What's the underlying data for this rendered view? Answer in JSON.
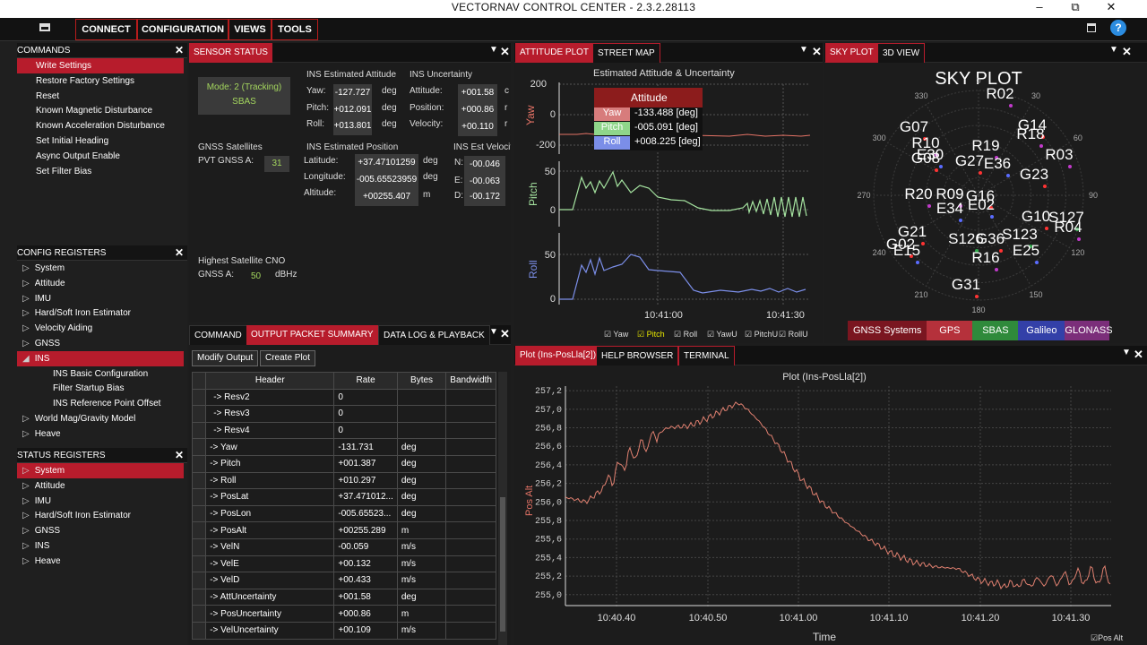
{
  "window": {
    "title": "VECTORNAV CONTROL CENTER - 2.3.2.28113",
    "minimize": "–",
    "restore": "⧉",
    "close": "✕"
  },
  "menu": {
    "connect": "CONNECT",
    "configuration": "CONFIGURATION",
    "views": "VIEWS",
    "tools": "TOOLS"
  },
  "commands": {
    "title": "COMMANDS",
    "items": [
      "Write Settings",
      "Restore Factory Settings",
      "Reset",
      "Known Magnetic Disturbance",
      "Known Acceleration Disturbance",
      "Set Initial Heading",
      "Async Output Enable",
      "Set Filter Bias"
    ]
  },
  "config": {
    "title": "CONFIG REGISTERS",
    "items": [
      "System",
      "Attitude",
      "IMU",
      "Hard/Soft Iron Estimator",
      "Velocity Aiding",
      "GNSS",
      "INS"
    ],
    "ins_children": [
      "INS Basic Configuration",
      "Filter Startup Bias",
      "INS Reference Point Offset"
    ],
    "after": [
      "World Mag/Gravity Model",
      "Heave"
    ]
  },
  "status": {
    "title": "STATUS REGISTERS",
    "items": [
      "System",
      "Attitude",
      "IMU",
      "Hard/Soft Iron Estimator",
      "GNSS",
      "INS",
      "Heave"
    ]
  },
  "sensor": {
    "tab": "SENSOR STATUS",
    "mode": "Mode: 2 (Tracking)",
    "sbas": "SBAS",
    "att_title": "INS Estimated Attitude",
    "yaw_l": "Yaw:",
    "yaw": "-127.727",
    "pitch_l": "Pitch:",
    "pitch": "+012.091",
    "roll_l": "Roll:",
    "roll": "+013.801",
    "deg": "deg",
    "unc_title": "INS Uncertainty",
    "att_l": "Attitude:",
    "att_u": "+001.58",
    "pos_l": "Position:",
    "pos_u": "+000.86",
    "vel_l": "Velocity:",
    "vel_u": "+00.110",
    "unc_unit1": "c",
    "unc_unit2": "r",
    "unc_unit3": "r",
    "gnss_title": "GNSS Satellites",
    "pvt_l": "PVT GNSS A:",
    "pvt": "31",
    "posn_title": "INS Estimated Position",
    "lat_l": "Latitude:",
    "lat": "+37.47101259",
    "lon_l": "Longitude:",
    "lon": "-005.65523959",
    "alt_l": "Altitude:",
    "alt": "+00255.407",
    "m": "m",
    "vel_title": "INS Est Velocit",
    "n_l": "N:",
    "n": "-00.046",
    "e_l": "E:",
    "e": "-00.063",
    "d_l": "D:",
    "d": "-00.172",
    "cno_title": "Highest Satellite CNO",
    "cno_l": "GNSS A:",
    "cno": "50",
    "cno_unit": "dBHz"
  },
  "bottom_tabs": {
    "command": "COMMAND",
    "output": "OUTPUT PACKET SUMMARY",
    "datalog": "DATA LOG & PLAYBACK",
    "modify": "Modify Output",
    "create": "Create Plot"
  },
  "packet": {
    "headers": [
      "Header",
      "Rate",
      "Bytes",
      "Bandwidth"
    ],
    "rows": [
      [
        "-> Resv2",
        "0",
        ""
      ],
      [
        "-> Resv3",
        "0",
        ""
      ],
      [
        "-> Resv4",
        "0",
        ""
      ],
      [
        "-> Yaw",
        "-131.731",
        "deg"
      ],
      [
        "-> Pitch",
        "+001.387",
        "deg"
      ],
      [
        "-> Roll",
        "+010.297",
        "deg"
      ],
      [
        "-> PosLat",
        "+37.471012...",
        "deg"
      ],
      [
        "-> PosLon",
        "-005.65523...",
        "deg"
      ],
      [
        "-> PosAlt",
        "+00255.289",
        "m"
      ],
      [
        "-> VelN",
        "-00.059",
        "m/s"
      ],
      [
        "-> VelE",
        "+00.132",
        "m/s"
      ],
      [
        "-> VelD",
        "+00.433",
        "m/s"
      ],
      [
        "-> AttUncertainty",
        "+001.58",
        "deg"
      ],
      [
        "-> PosUncertainty",
        "+000.86",
        "m"
      ],
      [
        "-> VelUncertainty",
        "+00.109",
        "m/s"
      ]
    ]
  },
  "attitude": {
    "tab": "ATTITUDE PLOT",
    "tab2": "STREET MAP",
    "title": "Estimated Attitude & Uncertainty",
    "yaw_axis": "Yaw",
    "pitch_axis": "Pitch",
    "roll_axis": "Roll",
    "t200": "200",
    "t0a": "0",
    "tm200": "-200",
    "t50a": "50",
    "t0b": "0",
    "t50b": "50",
    "t0c": "0",
    "time1": "10:41:00",
    "time2": "10:41:30",
    "popup_title": "Attitude",
    "p_yaw": "Yaw",
    "p_yaw_v": "-133.488 [deg]",
    "p_pitch": "Pitch",
    "p_pitch_v": "-005.091 [deg]",
    "p_roll": "Roll",
    "p_roll_v": "+008.225 [deg]",
    "legend": [
      "Yaw",
      "Pitch",
      "Roll",
      "YawU",
      "PitchU",
      "RollU"
    ]
  },
  "sky": {
    "tab": "SKY PLOT",
    "tab2": "3D VIEW",
    "title": "SKY PLOT",
    "angles": [
      "0",
      "30",
      "60",
      "90",
      "120",
      "150",
      "180",
      "210",
      "240",
      "270",
      "300",
      "330"
    ],
    "sats": [
      "R02",
      "G07",
      "G14",
      "R18",
      "R10",
      "R19",
      "E30",
      "G08",
      "G27",
      "R03",
      "E36",
      "G23",
      "R20",
      "R09",
      "G16",
      "E34",
      "E02",
      "G10",
      "S127",
      "R04",
      "G21",
      "S126",
      "G36",
      "S123",
      "G02",
      "E15",
      "E25",
      "R16",
      "G31"
    ],
    "systems": [
      "GNSS Systems",
      "GPS",
      "SBAS",
      "Galileo",
      "GLONASS"
    ]
  },
  "alt": {
    "tab": "Plot (Ins-PosLla[2])",
    "tab2": "HELP BROWSER",
    "tab3": "TERMINAL",
    "title": "Plot (Ins-PosLla[2])",
    "ylabel": "Pos Alt",
    "xlabel": "Time",
    "legend": "Pos Alt",
    "yticks": [
      "257,2",
      "257,0",
      "256,8",
      "256,6",
      "256,4",
      "256,2",
      "256,0",
      "255,8",
      "255,6",
      "255,4",
      "255,2",
      "255,0"
    ],
    "xticks": [
      "10:40.40",
      "10:40.50",
      "10:41.00",
      "10:41.10",
      "10:41.20",
      "10:41.30"
    ]
  },
  "colors": {
    "accent": "#b71c2c",
    "yaw": "#e57366",
    "pitch": "#a5e3a0",
    "roll": "#7b8ee8"
  }
}
